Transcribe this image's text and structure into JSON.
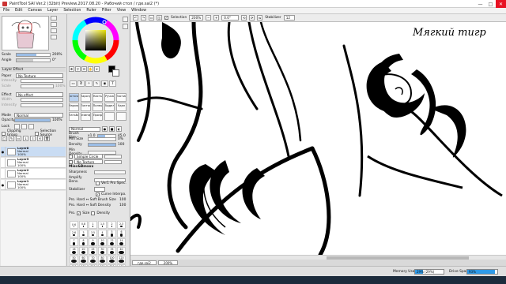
{
  "titlebar": {
    "title": "PaintTool SAI Ver.2 (32bit) Preview.2017.08.20 - Рабочий стол / где.sai2 (*)",
    "min": "—",
    "max": "□",
    "close": "✕"
  },
  "menu": [
    "File",
    "Edit",
    "Canvas",
    "Layer",
    "Selection",
    "Ruler",
    "Filter",
    "View",
    "Window"
  ],
  "toolbar": {
    "selection_label": "Selection",
    "zoom": "200%",
    "angle": "0.0°",
    "stabilizer_label": "Stabilizer",
    "stabilizer_value": "12",
    "mode_options": [
      "Normal"
    ]
  },
  "navigator": {
    "scale_label": "Scale",
    "scale_value": "200%",
    "angle_label": "Angle",
    "angle_value": "0°"
  },
  "layer_effect": {
    "header": "Layer Effect",
    "paper_label": "Paper",
    "paper_value": "No Texture",
    "intensity_label": "Intensity",
    "scale_label": "Scale",
    "scale_value": "100%",
    "effect_label": "Effect",
    "effect_value": "No effect",
    "width_label": "Width",
    "intensity2_label": "Intensity"
  },
  "layer_props": {
    "mode_label": "Mode",
    "mode_value": "Normal",
    "opacity_label": "Opacity",
    "opacity_value": "100%",
    "opacity_fraction": 1.0,
    "lock_label": "Lock",
    "clipping_label": "Clipping Group",
    "selection_source_label": "Selection Source"
  },
  "layers": [
    {
      "name": "Layer8",
      "mode": "Normal",
      "opacity": "100%",
      "selected": true
    },
    {
      "name": "Layer5",
      "mode": "Normal",
      "opacity": "100%",
      "selected": false
    },
    {
      "name": "Layer2",
      "mode": "Normal",
      "opacity": "100%",
      "selected": false
    },
    {
      "name": "Layer1",
      "mode": "Normal",
      "opacity": "100%",
      "selected": false
    }
  ],
  "brushes": [
    {
      "label": "Кисточка",
      "selected": true
    },
    {
      "label": "Аэрогр",
      "selected": false
    },
    {
      "label": "Кисть",
      "selected": false
    },
    {
      "label": "Ручка",
      "selected": false
    },
    {
      "label": "Ластик",
      "selected": false
    },
    {
      "label": "Маркер",
      "selected": false
    },
    {
      "label": "Листок",
      "selected": false
    },
    {
      "label": "Палец",
      "selected": false
    },
    {
      "label": "Выдел",
      "selected": false
    },
    {
      "label": "Удал",
      "selected": false
    },
    {
      "label": "Чатьба",
      "selected": false
    },
    {
      "label": "Дезинфе",
      "selected": false
    },
    {
      "label": "Прозр",
      "selected": false
    },
    {
      "label": "",
      "selected": false
    },
    {
      "label": "",
      "selected": false
    }
  ],
  "brush_props": {
    "mode_value": "Normal",
    "size_label": "Brush Size",
    "size_multiplier": "x1.0",
    "size_value": "45.0",
    "min_size_label": "Min Size",
    "min_size_value": "0%",
    "density_label": "Density",
    "density_value": "100",
    "min_density_label": "Min Density",
    "shape_value": "Simple Circle",
    "texture_value": "No Texture",
    "mix_header": "Misc&Bmxxx",
    "sharpness_label": "Sharpness",
    "amplify_label": "Amplify Dens.",
    "ver1_label": "Ver1 Pro Spec.",
    "stabilizer_label": "Stabilizer",
    "curve_label": "Curve Interpo.",
    "hard_soft_size_label": "Pro. Hard ↔ Soft Brush Size",
    "hard_soft_size_value": "100",
    "hard_soft_density_label": "Pro. Hard ↔ Soft Density",
    "hard_soft_density_value": "100",
    "pressure_label": "Pro.",
    "pressure_size": "Size",
    "pressure_density": "Density"
  },
  "size_presets": [
    "0.6",
    "0.8",
    "1",
    "1.5",
    "2",
    "2.3",
    "2.6",
    "3",
    "3.5",
    "4",
    "5",
    "6",
    "7",
    "8",
    "9",
    "10",
    "12",
    "14",
    "16",
    "20",
    "25",
    "30",
    "35",
    "40",
    "50",
    "60",
    "70",
    "80",
    "100",
    "120",
    "150",
    "200",
    "250",
    "300",
    "350",
    "400"
  ],
  "canvas": {
    "watermark": "Мягкий тигр"
  },
  "doc_tab": {
    "name": "где.sai2",
    "zoom": "200%"
  },
  "status": {
    "memory_label": "Memory Usage",
    "memory_value": "29% (29%)",
    "memory_fraction": 0.29,
    "drive_label": "Drive Space",
    "drive_value": "93%",
    "drive_fraction": 0.93
  }
}
